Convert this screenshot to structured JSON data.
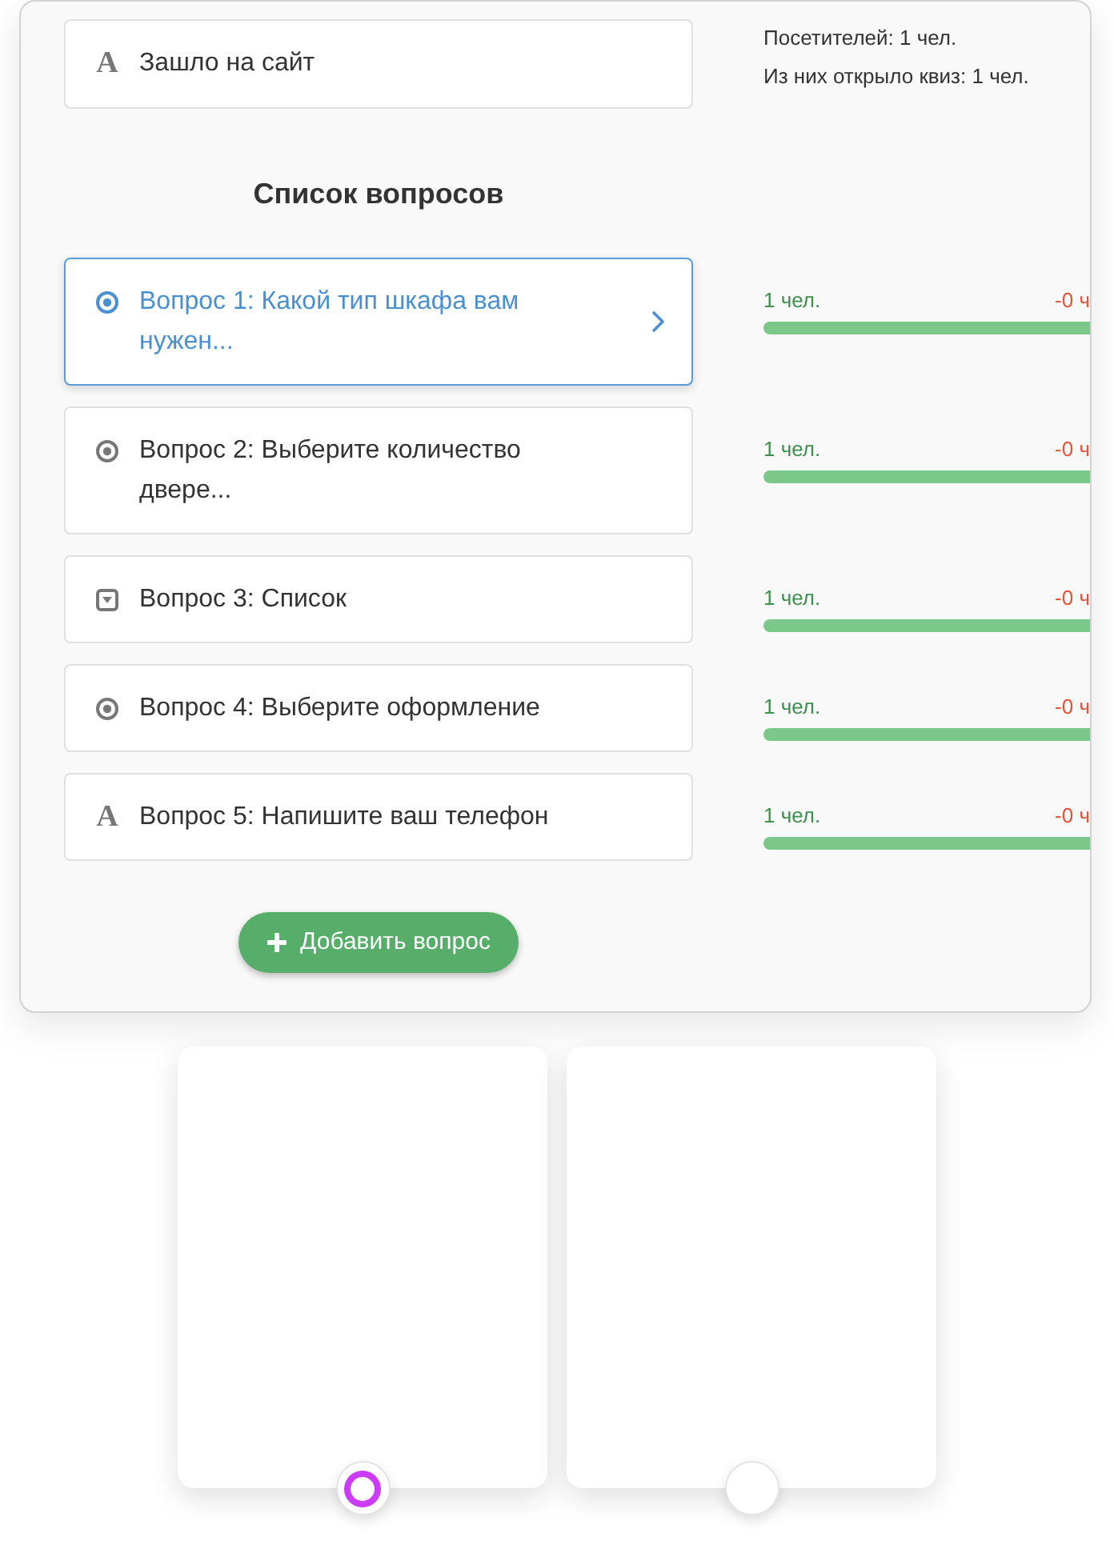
{
  "entry_step": {
    "kind": "text",
    "icon_char": "A",
    "label": "Зашло на сайт"
  },
  "visitor_stats": [
    "Посетителей: 1 чел.",
    "Из них открыло квиз: 1 чел."
  ],
  "questions_heading": "Список вопросов",
  "questions": [
    {
      "kind": "radio",
      "label": "Вопрос 1: Какой тип шкафа вам нужен...",
      "selected": true,
      "count": "1 чел.",
      "dropoff": "-0 ч",
      "level": 1
    },
    {
      "kind": "radio",
      "label": "Вопрос 2: Выберите количество двере...",
      "selected": false,
      "count": "1 чел.",
      "dropoff": "-0 ч",
      "level": 1
    },
    {
      "kind": "select",
      "label": "Вопрос 3: Список",
      "selected": false,
      "count": "1 чел.",
      "dropoff": "-0 ч",
      "level": 1
    },
    {
      "kind": "radio",
      "label": "Вопрос 4: Выберите оформление",
      "selected": false,
      "count": "1 чел.",
      "dropoff": "-0 ч",
      "level": 1
    },
    {
      "kind": "text",
      "icon_char": "A",
      "label": "Вопрос 5: Напишите ваш телефон",
      "selected": false,
      "count": "1 чел.",
      "dropoff": "-0 ч",
      "level": 1
    }
  ],
  "add_button": {
    "label": "Добавить вопрос"
  },
  "answer_cards": [
    {
      "selected": true
    },
    {
      "selected": false
    }
  ]
}
